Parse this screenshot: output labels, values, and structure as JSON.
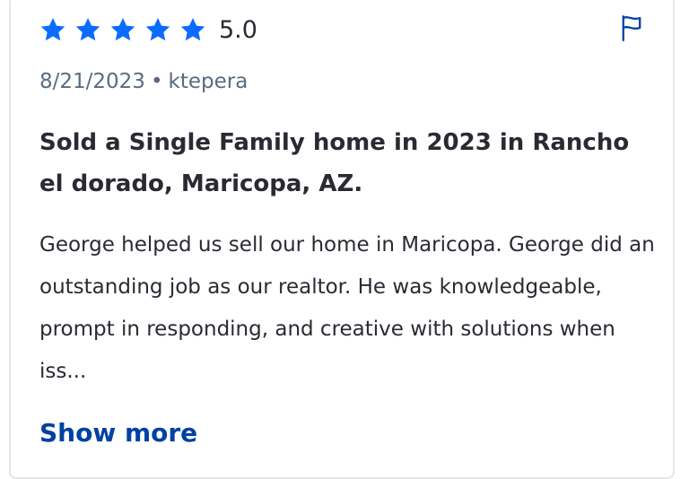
{
  "review": {
    "rating": 5,
    "rating_label": "5.0",
    "star_icon": "star-filled-icon",
    "star_color": "#0b6cff",
    "flag_icon": "flag-icon",
    "date": "8/21/2023",
    "separator": "•",
    "author": "ktepera",
    "title": "Sold a Single Family home in 2023 in Rancho el dorado, Maricopa, AZ.",
    "body": "George helped us sell our home in Maricopa. George did an outstanding job as our realtor. He was knowledgeable, prompt in responding, and creative with solutions when iss...",
    "show_more_label": "Show more",
    "link_color": "#0041a3"
  }
}
